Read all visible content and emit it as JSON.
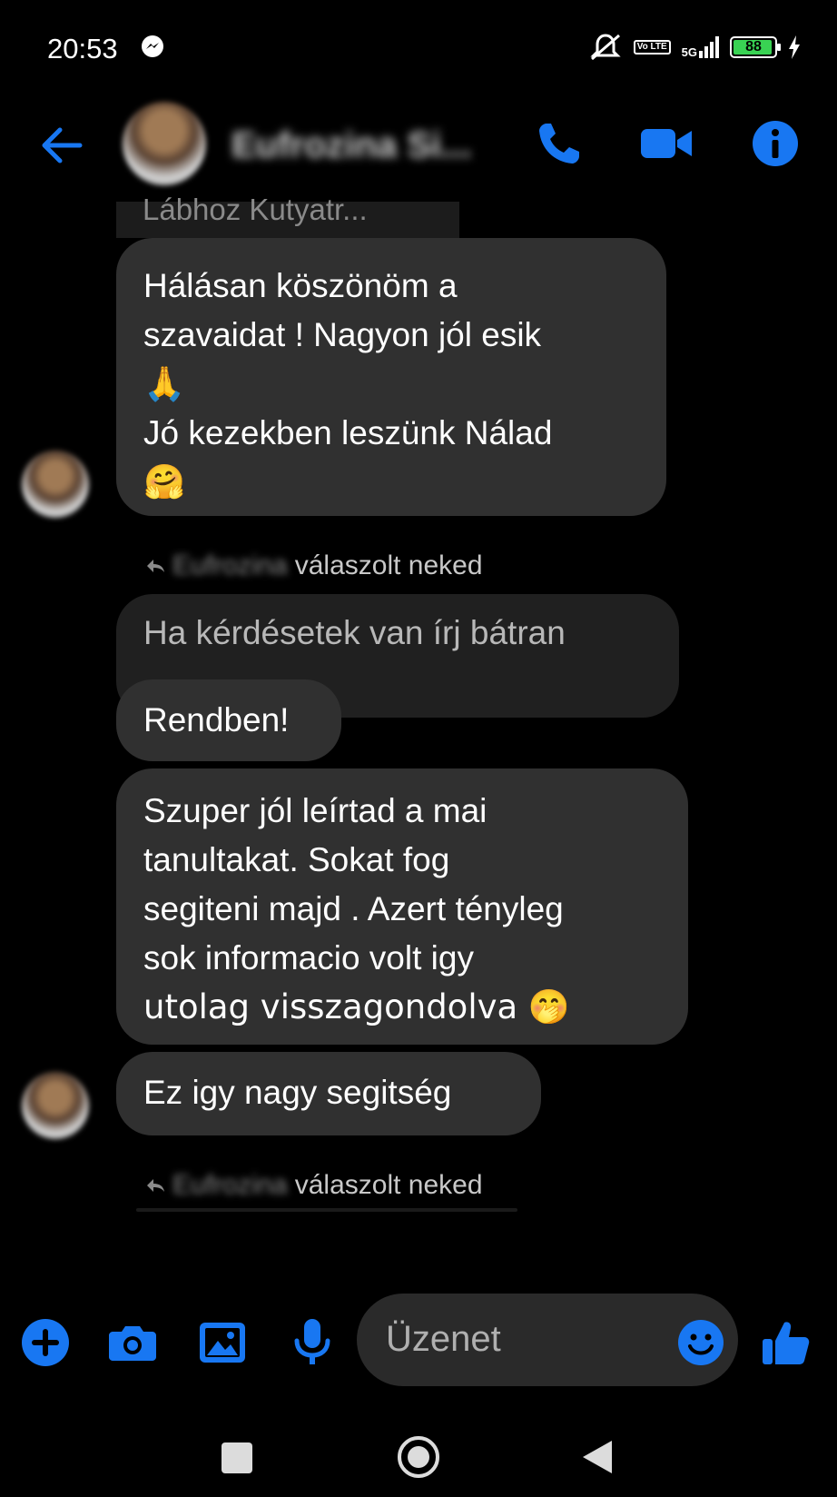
{
  "status_bar": {
    "time": "20:53",
    "battery": "88",
    "network": "5G",
    "volte": "Vo LTE"
  },
  "header": {
    "contact_name": "Eufrozina Si..."
  },
  "colors": {
    "accent": "#1877f2",
    "bubble": "#303030",
    "reply_bubble": "#202020",
    "battery": "#39d353"
  },
  "quote_snippet": "Lábhoz Kutyatr...",
  "messages": [
    {
      "text_lines": [
        "Hálásan köszönöm a",
        "szavaidat ! Nagyon jól esik",
        "🙏",
        "Jó kezekben leszünk Nálad",
        "🤗"
      ]
    },
    {
      "replied_prefix_name": "Eufrozina",
      "replied_label": "válaszolt neked"
    },
    {
      "reply_quote": "Ha kérdésetek van írj bátran"
    },
    {
      "text": "Rendben!"
    },
    {
      "text_lines": [
        "Szuper jól leírtad a mai",
        "tanultakat. Sokat fog",
        "segiteni majd . Azert tényleg",
        "sok informacio volt igy",
        "utolag visszagondolva 🤭"
      ]
    },
    {
      "text": "Ez igy nagy segitség"
    },
    {
      "replied_prefix_name": "Eufrozina",
      "replied_label": "válaszolt neked"
    }
  ],
  "composer": {
    "placeholder": "Üzenet"
  },
  "icons": [
    "back-arrow-icon",
    "phone-icon",
    "video-icon",
    "info-icon",
    "plus-icon",
    "camera-icon",
    "gallery-icon",
    "mic-icon",
    "emoji-icon",
    "like-icon"
  ]
}
